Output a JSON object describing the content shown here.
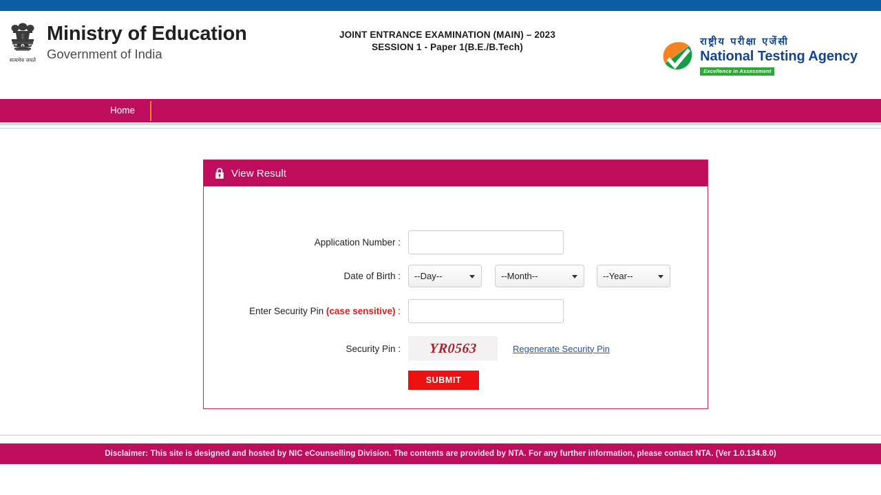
{
  "colors": {
    "top_strip": "#0c5fa5",
    "brand_pink": "#bf0d5e",
    "nav_separator": "#f08a1e",
    "submit_red": "#ee1111",
    "link_blue": "#2155a8",
    "nta_blue": "#14438f",
    "tagline_green": "#2ea836",
    "captcha_red": "#9e2733",
    "case_sensitive_red": "#e01b1b"
  },
  "header": {
    "ministry_title": "Ministry of Education",
    "ministry_subtitle": "Government of India",
    "emblem_motto": "सत्यमेव जयते",
    "exam_line1": "JOINT ENTRANCE EXAMINATION (MAIN) – 2023",
    "exam_line2": "SESSION 1 - Paper 1(B.E./B.Tech)",
    "nta_hindi": "राष्ट्रीय परीक्षा एजेंसी",
    "nta_english": "National Testing Agency",
    "nta_tagline": "Excellence in Assessment"
  },
  "nav": {
    "items": [
      {
        "label": "Home"
      }
    ]
  },
  "card": {
    "title": "View Result",
    "lock_icon": "lock-icon",
    "fields": {
      "application_number": {
        "label": "Application Number :",
        "value": "",
        "placeholder": ""
      },
      "date_of_birth": {
        "label": "Date of Birth :",
        "day": "--Day--",
        "month": "--Month--",
        "year": "--Year--"
      },
      "security_pin_entry": {
        "label_prefix": "Enter Security Pin ",
        "label_emphasis": "(case sensitive)",
        "label_suffix": " :",
        "value": "",
        "placeholder": ""
      },
      "security_pin_display": {
        "label": "Security Pin :",
        "captcha_value": "YR0563",
        "regenerate_link": "Regenerate Security Pin"
      }
    },
    "submit_label": "SUBMIT"
  },
  "footer": {
    "disclaimer": "Disclaimer: This site is designed and hosted by NIC eCounselling Division. The contents are provided by NTA. For any further information, please contact NTA. (Ver 1.0.134.8.0)"
  }
}
